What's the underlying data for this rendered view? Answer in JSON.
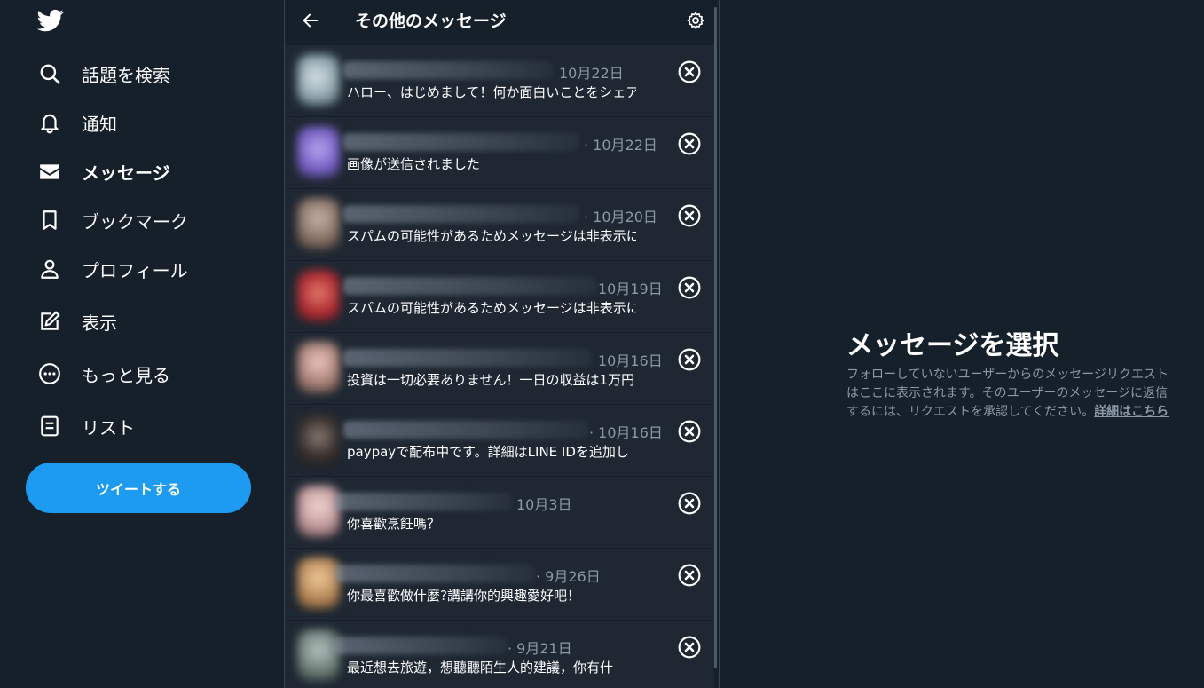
{
  "nav": {
    "items": [
      {
        "label": "話題を検索",
        "icon": "search-icon"
      },
      {
        "label": "通知",
        "icon": "bell-icon"
      },
      {
        "label": "メッセージ",
        "icon": "envelope-icon",
        "active": true
      },
      {
        "label": "ブックマーク",
        "icon": "bookmark-icon"
      },
      {
        "label": "プロフィール",
        "icon": "person-icon"
      },
      {
        "label": "表示",
        "icon": "edit-icon"
      },
      {
        "label": "もっと見る",
        "icon": "more-icon"
      },
      {
        "label": "リスト",
        "icon": "list-icon"
      }
    ],
    "tweet_button": "ツイートする"
  },
  "messages": {
    "title": "その他のメッセージ",
    "rows": [
      {
        "date": "10月22日",
        "preview": "ハロー、はじめまして！何か面白いことをシェアしなが"
      },
      {
        "date": "· 10月22日",
        "preview": "画像が送信されました"
      },
      {
        "date": "· 10月20日",
        "preview": "スパムの可能性があるためメッセージは非表示にな:"
      },
      {
        "date": "10月19日",
        "preview": "スパムの可能性があるためメッセージは非表示にな:"
      },
      {
        "date": "10月16日",
        "preview": "投資は一切必要ありません！一日の収益は1万円"
      },
      {
        "date": "· 10月16日",
        "preview": "paypayで配布中です。詳細はLINE IDを追加し"
      },
      {
        "date": "10月3日",
        "preview": "你喜歡烹飪嗎？"
      },
      {
        "date": "· 9月26日",
        "preview": "你最喜歡做什麼?講講你的興趣愛好吧！"
      },
      {
        "date": "· 9月21日",
        "preview": "最近想去旅遊，想聽聽陌生人的建議，你有什"
      }
    ]
  },
  "detail": {
    "title": "メッセージを選択",
    "description": "フォローしていないユーザーからのメッセージリクエストはここに表示されます。そのユーザーのメッセージに返信するには、リクエストを承認してください。",
    "link": "詳細はこちら"
  },
  "colors": {
    "background": "#15202b",
    "row_background": "#1e2732",
    "accent": "#1d9bf0",
    "muted_text": "#8b98a5"
  }
}
